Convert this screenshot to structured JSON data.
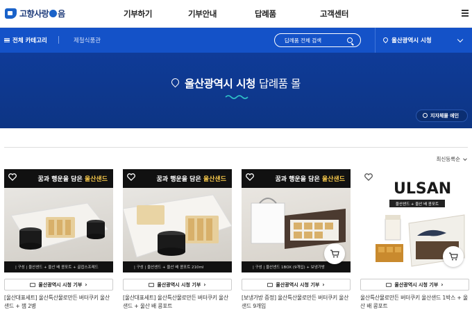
{
  "brand": {
    "logo_text_1": "고향사랑",
    "logo_text_2": "음"
  },
  "nav": {
    "items": [
      "기부하기",
      "기부안내",
      "답례품",
      "고객센터"
    ]
  },
  "subbar": {
    "all_category": "전체 카테고리",
    "breadcrumb": "제철식품관",
    "search_placeholder": "답례품 전체 검색",
    "location": "울산광역시 시청"
  },
  "hero": {
    "title_bold": "울산광역시 시청",
    "title_rest": "답례품 몰",
    "local_button": "지자체몰 에인"
  },
  "sort": {
    "label": "최신등록순"
  },
  "colors": {
    "primary": "#1452c8",
    "hero": "#0f3b98",
    "accent_gold": "#f4c64a"
  },
  "products": [
    {
      "banner": "꿈과 행운을 담은",
      "banner_strong": "울산샌드",
      "caption": "| 구성 | 울산샌드 + 울산 배 콩포트 + 골잡스프레드",
      "donate_label": "울산광역시 시청 기부",
      "desc": "[울산대표세트] 울산특산물로만든 버터쿠키 울산샌드 + 잼 2병"
    },
    {
      "banner": "꿈과 행운을 담은",
      "banner_strong": "울산샌드",
      "caption": "| 구성 | 울산샌드 + 울산 배 콩포트 210ml",
      "donate_label": "울산광역시 시청 기부",
      "desc": "[울산대표세트] 울산특산물로만든 버터쿠키 울산샌드 + 울산 배 콩포트"
    },
    {
      "banner": "꿈과 행운을 담은",
      "banner_strong": "울산샌드",
      "caption": "| 구성 | 울산샌드 1BOX (9개입) + 보냉가방",
      "donate_label": "울산광역시 시청 기부",
      "desc": "[보냉가방 증정] 울산특산물로만든 버터쿠키 울산샌드 9개입"
    },
    {
      "logo": "ULSAN",
      "strip": "울산샌드 + 울산 배 콩포트",
      "donate_label": "울산광역시 시청 기부",
      "desc": "울산특산물로만든 버터쿠키 울산샌드 1박스 + 울산 배 콩포트"
    }
  ]
}
